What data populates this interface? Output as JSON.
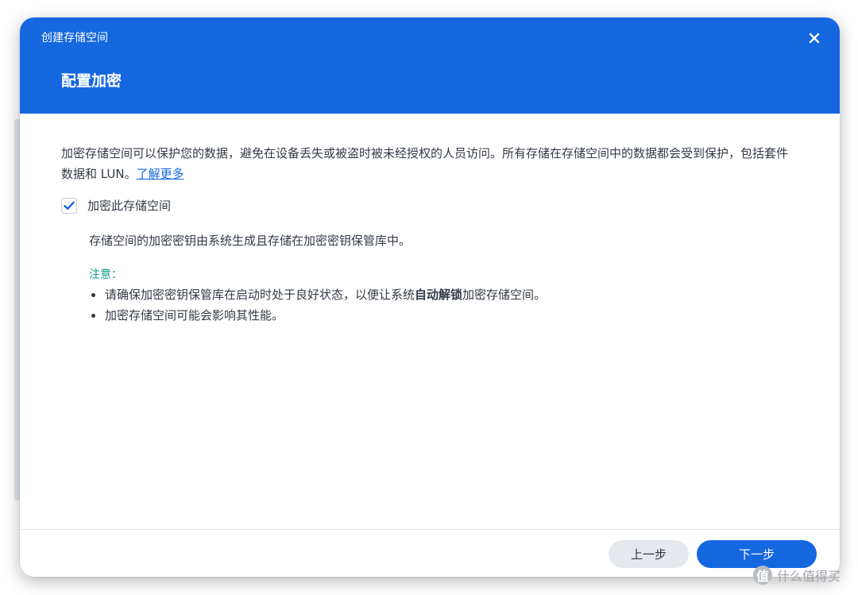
{
  "window": {
    "title": "创建存储空间",
    "close_icon": "close-icon"
  },
  "header": {
    "heading": "配置加密"
  },
  "intro": {
    "text": "加密存储空间可以保护您的数据，避免在设备丢失或被盗时被未经授权的人员访问。所有存储在存储空间中的数据都会受到保护，包括套件数据和 LUN。",
    "link_label": "了解更多"
  },
  "encrypt_option": {
    "label": "加密此存储空间",
    "checked": true,
    "description": "存储空间的加密密钥由系统生成且存储在加密密钥保管库中。"
  },
  "note": {
    "title": "注意：",
    "items": [
      {
        "before": "请确保加密密钥保管库在启动时处于良好状态，以便让系统",
        "bold": "自动解锁",
        "after": "加密存储空间。"
      },
      {
        "text": "加密存储空间可能会影响其性能。"
      }
    ]
  },
  "footer": {
    "prev_label": "上一步",
    "next_label": "下一步"
  },
  "watermark": {
    "text": "什么值得买",
    "logo_char": "值"
  },
  "colors": {
    "accent": "#1567e0",
    "note_title": "#169a8c",
    "prev_button_bg": "#e5e9ee"
  }
}
